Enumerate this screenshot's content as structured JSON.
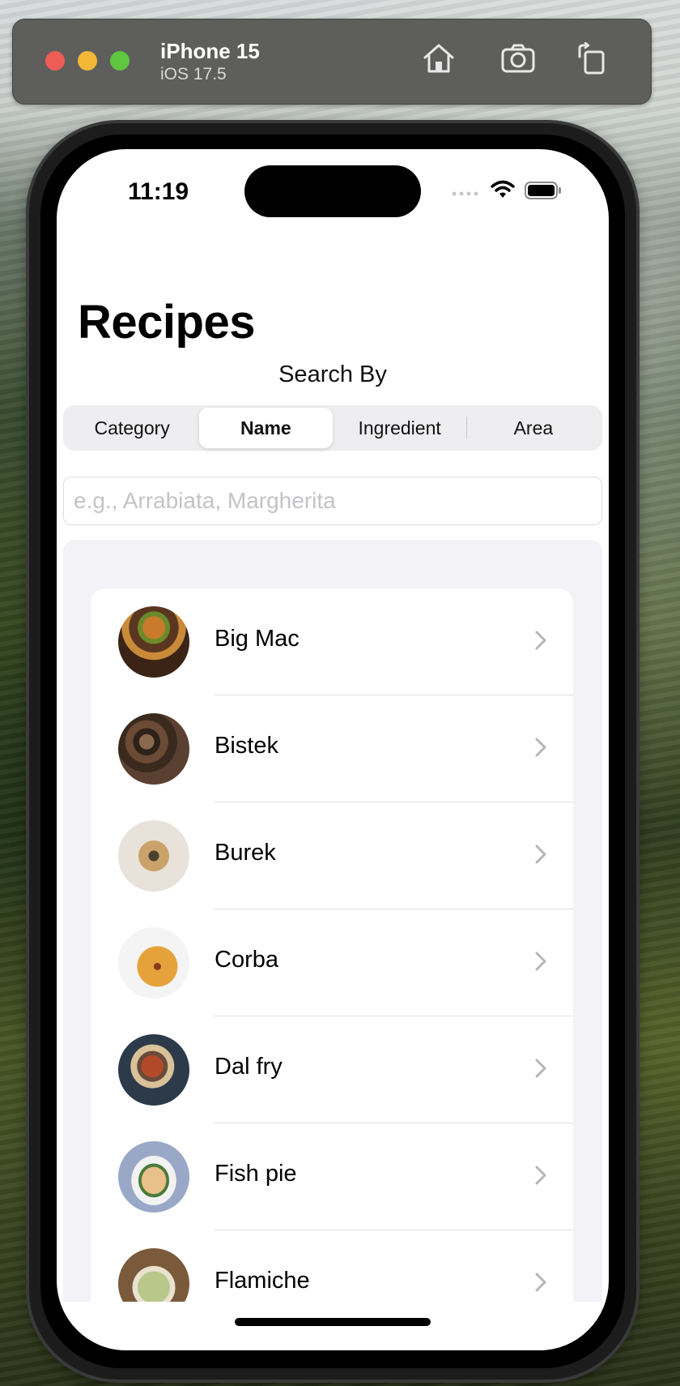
{
  "simulator": {
    "device_name": "iPhone 15",
    "os_version": "iOS 17.5",
    "toolbar_icons": [
      "home-icon",
      "screenshot-icon",
      "rotate-icon"
    ]
  },
  "status_bar": {
    "time": "11:19"
  },
  "page": {
    "title": "Recipes",
    "search_by_label": "Search By"
  },
  "segments": [
    {
      "label": "Category",
      "selected": false
    },
    {
      "label": "Name",
      "selected": true
    },
    {
      "label": "Ingredient",
      "selected": false
    },
    {
      "label": "Area",
      "selected": false
    }
  ],
  "search": {
    "placeholder": "e.g., Arrabiata, Margherita",
    "value": ""
  },
  "recipes": [
    {
      "name": "Big Mac",
      "thumb_colors": [
        "#3b2416",
        "#c97a2c",
        "#6b8a2a"
      ]
    },
    {
      "name": "Bistek",
      "thumb_colors": [
        "#2e2119",
        "#6b4b35",
        "#8a6a4e"
      ]
    },
    {
      "name": "Burek",
      "thumb_colors": [
        "#e8e2da",
        "#caa36a",
        "#4a4034"
      ]
    },
    {
      "name": "Corba",
      "thumb_colors": [
        "#ffffff",
        "#e6a23a",
        "#8a3a1e"
      ]
    },
    {
      "name": "Dal fry",
      "thumb_colors": [
        "#2c3a4a",
        "#b24a2a",
        "#d9c29a"
      ]
    },
    {
      "name": "Fish pie",
      "thumb_colors": [
        "#f2f2f2",
        "#e9c08a",
        "#4a7a3a"
      ]
    },
    {
      "name": "Flamiche",
      "thumb_colors": [
        "#7a5a3a",
        "#b9c88a",
        "#e9e2cf"
      ]
    }
  ],
  "colors": {
    "accent_segment_bg": "#eeeef0",
    "list_background": "#f2f2f7",
    "traffic_red": "#ee5c55",
    "traffic_yellow": "#f2b736",
    "traffic_green": "#5fc640"
  }
}
